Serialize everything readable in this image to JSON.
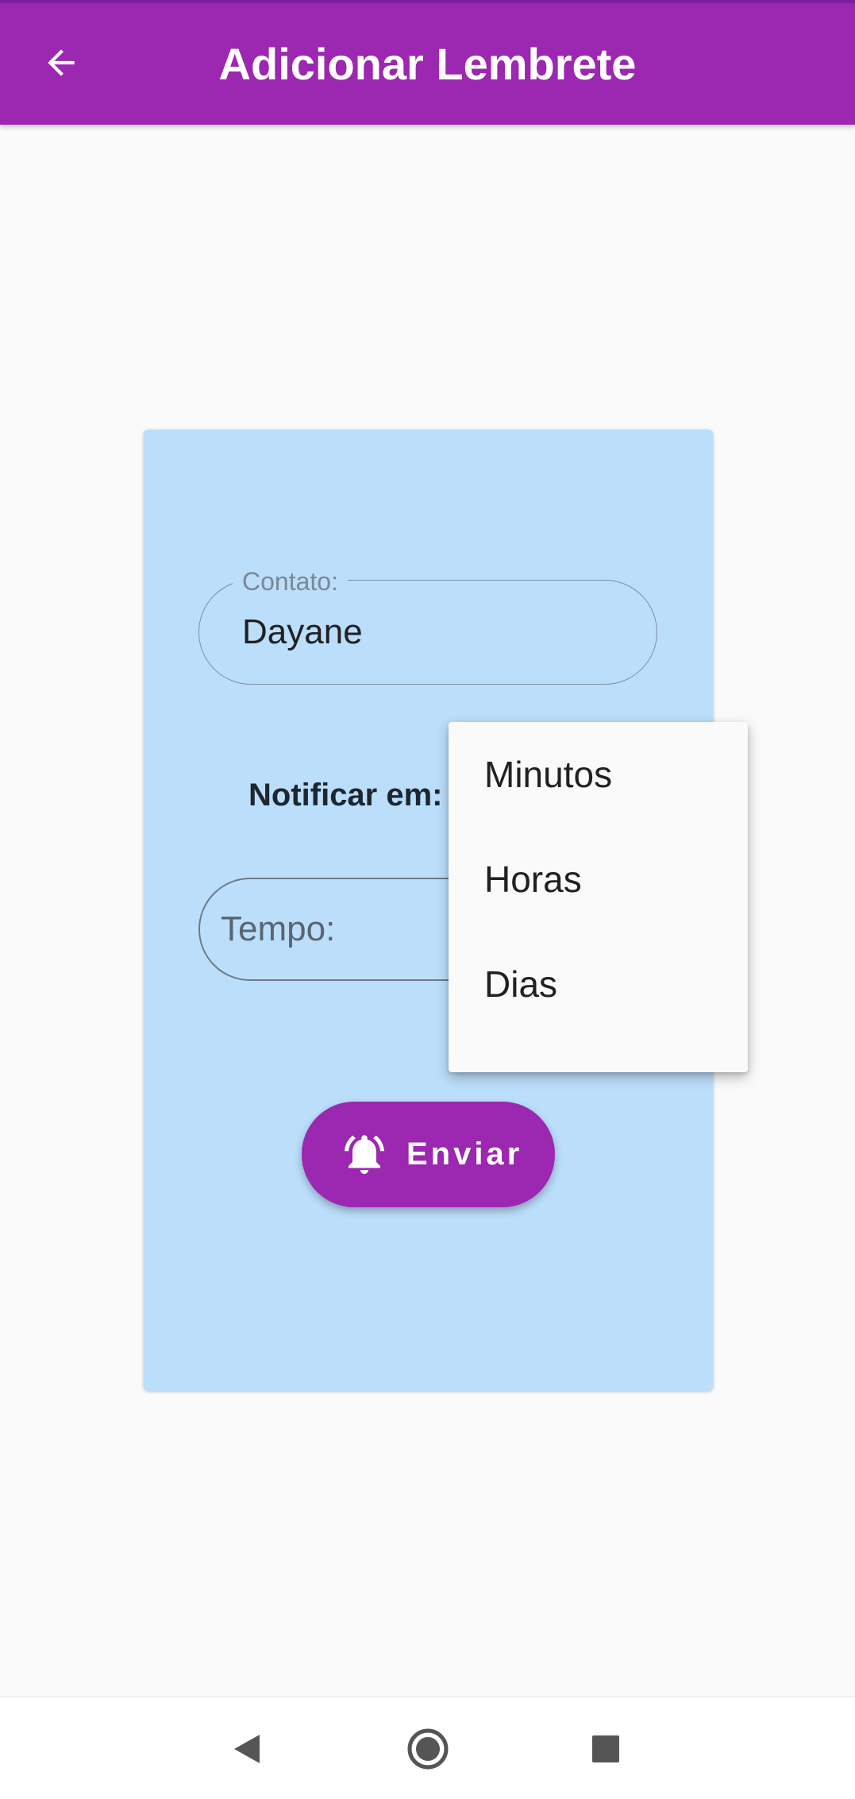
{
  "app_bar": {
    "title": "Adicionar Lembrete",
    "back_icon": "arrow-back-icon",
    "color": "#9c27b0"
  },
  "form": {
    "contact": {
      "label": "Contato:",
      "value": "Dayane"
    },
    "notify_label": "Notificar em:",
    "time": {
      "placeholder": "Tempo:"
    },
    "send_button": {
      "label": "Enviar",
      "icon": "notifications-active-icon"
    },
    "card_color": "#bbdefb"
  },
  "dropdown": {
    "options": [
      {
        "label": "Minutos"
      },
      {
        "label": "Horas"
      },
      {
        "label": "Dias"
      }
    ]
  },
  "system_nav": {
    "back_icon": "nav-back-icon",
    "home_icon": "nav-home-icon",
    "recents_icon": "nav-recents-icon"
  }
}
